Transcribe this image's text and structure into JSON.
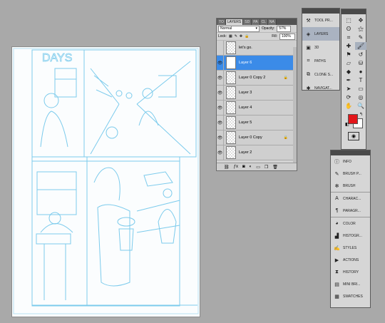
{
  "canvas": {
    "caption": "DAYS"
  },
  "layers_panel": {
    "tabs": [
      "TO",
      "LAYERS",
      "SD",
      "PA",
      "CL",
      "NA"
    ],
    "blend_mode": "Normal",
    "opacity_label": "Opacity:",
    "opacity_value": "57%",
    "lock_label": "Lock:",
    "fill_label": "Fill:",
    "fill_value": "100%",
    "layers": [
      {
        "name": "let's go.",
        "visible": false,
        "locked": false,
        "selected": false
      },
      {
        "name": "Layer 6",
        "visible": true,
        "locked": false,
        "selected": true
      },
      {
        "name": "Layer 0 Copy 2",
        "visible": true,
        "locked": true,
        "selected": false
      },
      {
        "name": "Layer 3",
        "visible": true,
        "locked": false,
        "selected": false
      },
      {
        "name": "Layer 4",
        "visible": true,
        "locked": false,
        "selected": false
      },
      {
        "name": "Layer 5",
        "visible": true,
        "locked": false,
        "selected": false
      },
      {
        "name": "Layer 0 Copy",
        "visible": true,
        "locked": true,
        "selected": false
      },
      {
        "name": "Layer 2",
        "visible": true,
        "locked": false,
        "selected": false
      }
    ]
  },
  "dock_top": {
    "items": [
      "TOOL PR...",
      "LAYERS",
      "3D",
      "PATHS",
      "CLONE S...",
      "NAVIGAT..."
    ]
  },
  "dock_bottom": {
    "items": [
      "INFO",
      "BRUSH P...",
      "BRUSH",
      "CHARAC...",
      "PARAGR...",
      "COLOR",
      "HISTOGR...",
      "STYLES",
      "ACTIONS",
      "HISTORY",
      "MINI BRI...",
      "SWATCHES"
    ]
  },
  "colors": {
    "foreground": "#e3161a",
    "background": "#ffffff",
    "selection": "#3b8be8",
    "sketch": "#6fc3e8"
  }
}
